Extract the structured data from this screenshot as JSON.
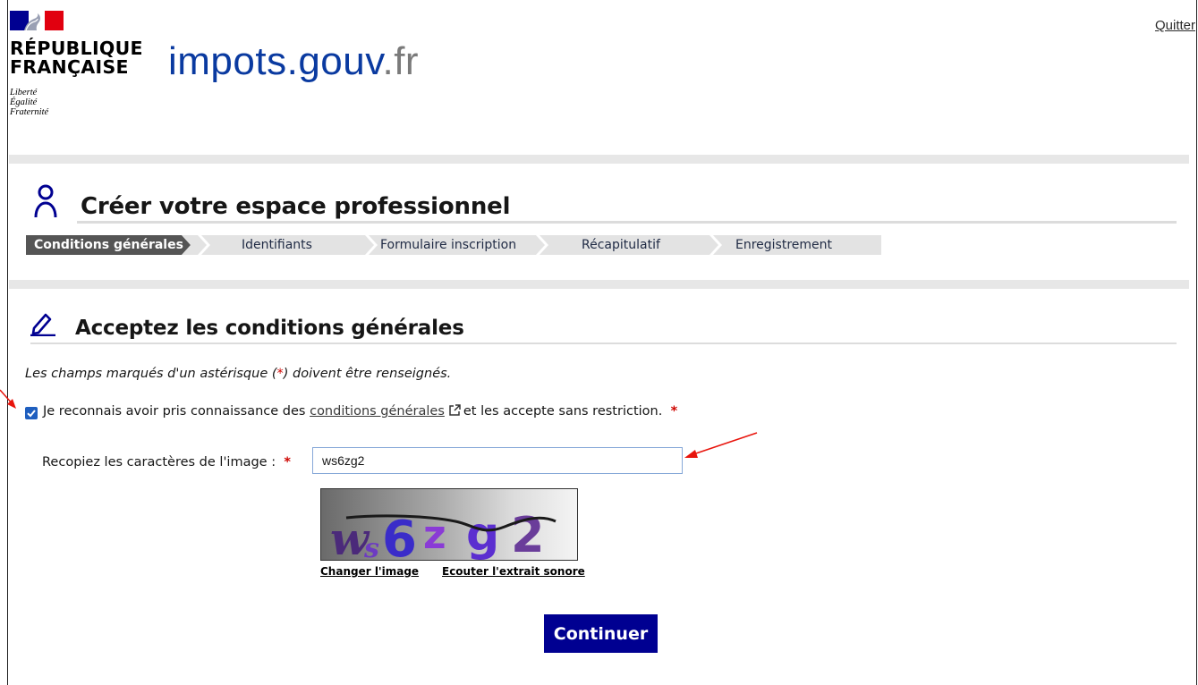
{
  "header": {
    "republic_name": "RÉPUBLIQUE\nFRANÇAISE",
    "motto": "Liberté\nÉgalité\nFraternité",
    "site_name_main": "impots.gouv",
    "site_name_tld": ".fr",
    "quit_label": "Quitter"
  },
  "page": {
    "title": "Créer votre espace professionnel",
    "steps": [
      {
        "label": "Conditions générales",
        "active": true
      },
      {
        "label": "Identifiants",
        "active": false
      },
      {
        "label": "Formulaire inscription",
        "active": false
      },
      {
        "label": "Récapitulatif",
        "active": false
      },
      {
        "label": "Enregistrement",
        "active": false
      }
    ]
  },
  "section": {
    "title": "Acceptez les conditions générales",
    "hint_before": "Les champs marqués d'un astérisque (",
    "hint_star": "*",
    "hint_after": ") doivent être renseignés."
  },
  "terms": {
    "checked": true,
    "text_before": "Je reconnais avoir pris connaissance des ",
    "link_label": "conditions générales",
    "text_after": "et les accepte sans restriction.",
    "required_mark": "*"
  },
  "captcha": {
    "label": "Recopiez les caractères de l'image :",
    "required_mark": "*",
    "value": "ws6zg2",
    "image_characters": [
      "w",
      "s",
      "6",
      "z",
      "g",
      "2"
    ],
    "change_image_label": "Changer l'image",
    "audio_label": "Ecouter l'extrait sonore"
  },
  "submit_label": "Continuer",
  "colors": {
    "brand_blue": "#000091",
    "site_title_blue": "#0a3aa0",
    "required_red": "#ce0500",
    "annotation_red": "#e8140c"
  }
}
